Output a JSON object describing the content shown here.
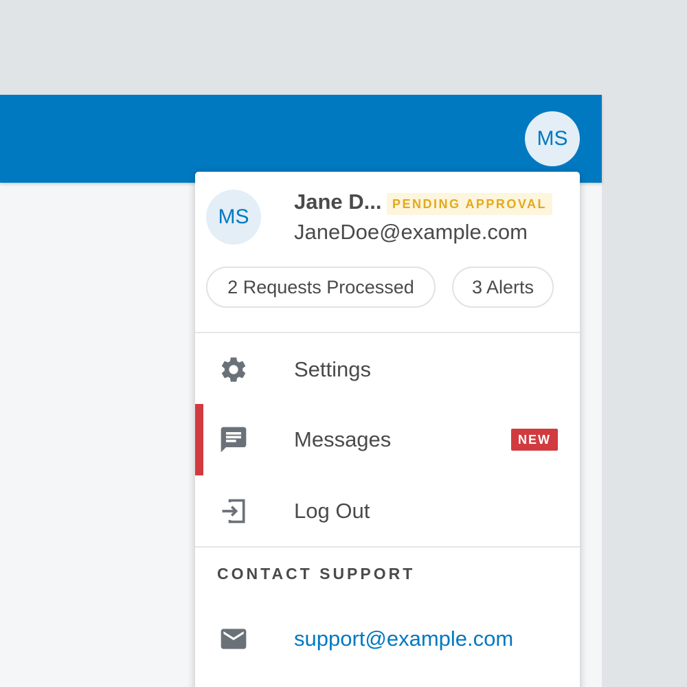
{
  "header": {
    "avatar_initials": "MS",
    "brand_color": "#0079c1"
  },
  "user_menu": {
    "avatar_initials": "MS",
    "name": "Jane D...",
    "status_badge": "PENDING APPROVAL",
    "email": "JaneDoe@example.com",
    "stats": [
      {
        "label": "2 Requests Processed"
      },
      {
        "label": "3 Alerts"
      }
    ],
    "items": [
      {
        "label": "Settings",
        "icon": "gear-icon"
      },
      {
        "label": "Messages",
        "icon": "chat-icon",
        "badge": "NEW",
        "active": true
      },
      {
        "label": "Log Out",
        "icon": "logout-icon"
      }
    ],
    "contact_section": {
      "title": "CONTACT SUPPORT",
      "email": "support@example.com",
      "icon": "mail-icon"
    }
  },
  "colors": {
    "accent": "#0079c1",
    "alert": "#d13b3f",
    "warning_text": "#e3a91c",
    "warning_bg": "#fdf5dc",
    "icon": "#6b7178"
  }
}
